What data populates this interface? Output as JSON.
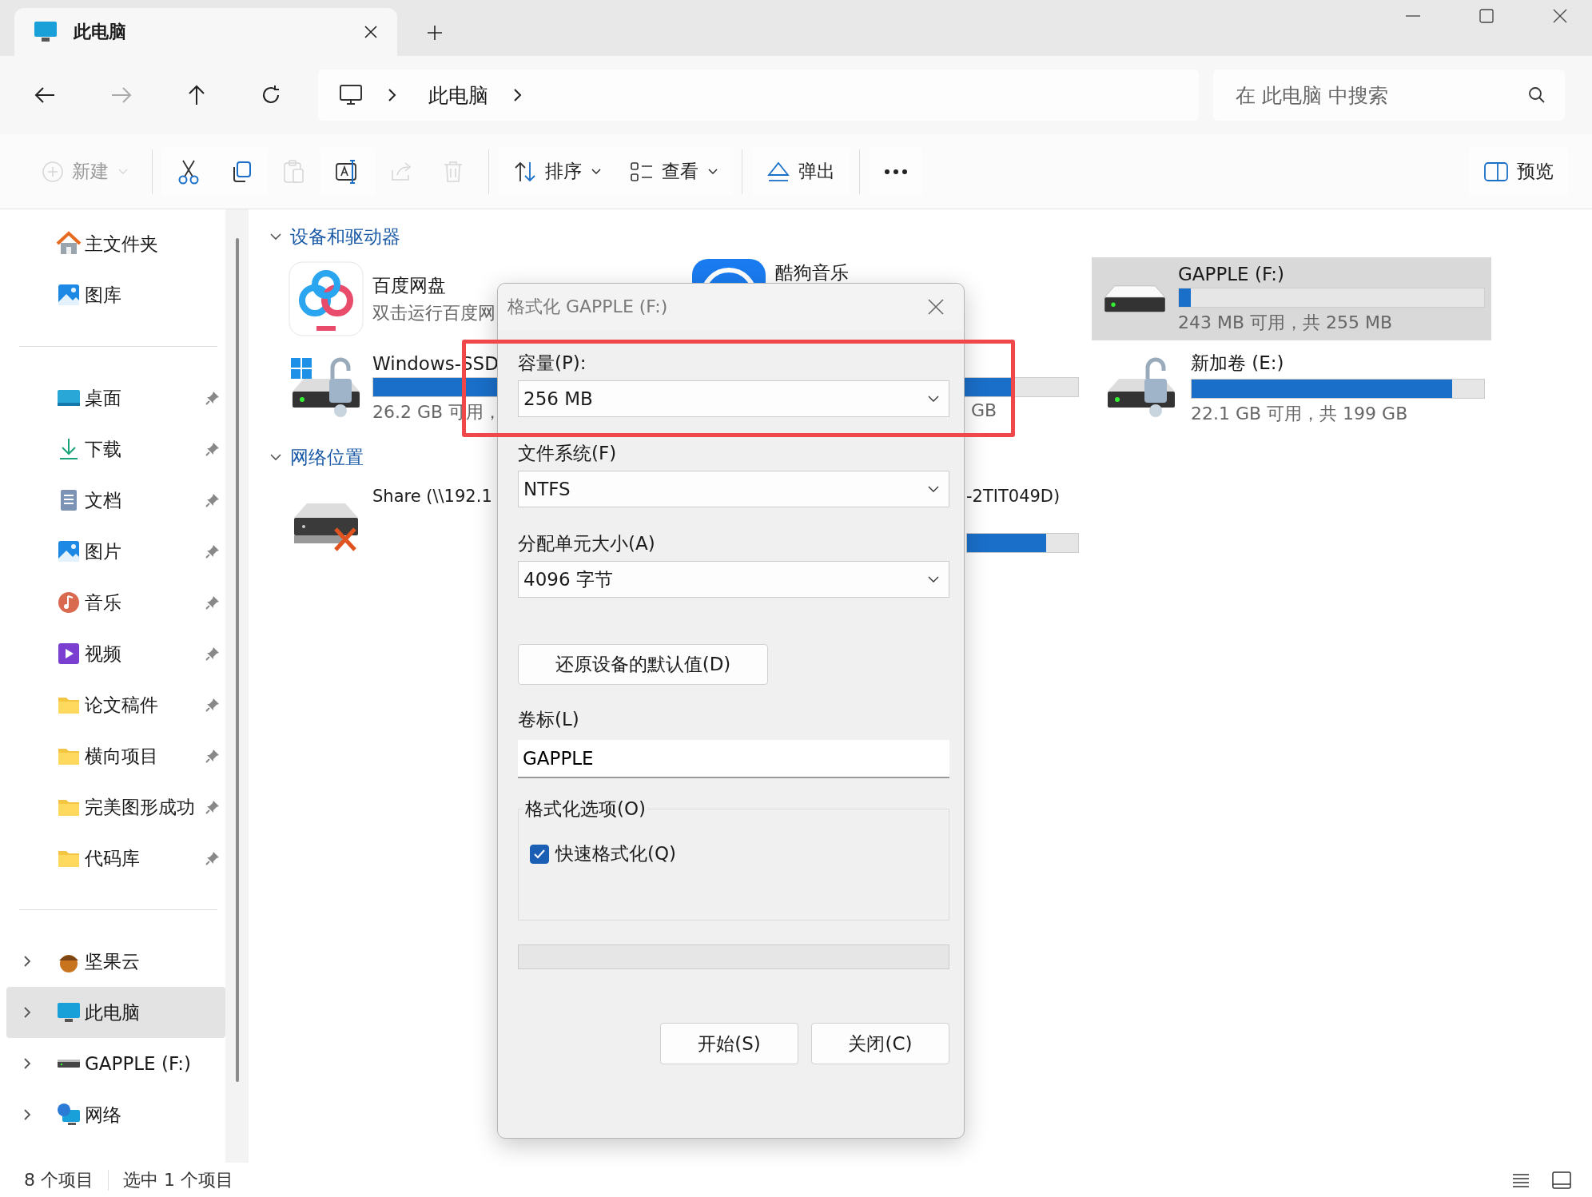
{
  "window": {
    "tab_title": "此电脑"
  },
  "nav": {
    "back_disabled": false,
    "forward_disabled": true,
    "breadcrumb": [
      "此电脑"
    ],
    "search": {
      "placeholder": "在 此电脑 中搜索"
    }
  },
  "toolbar": [
    {
      "kind": "new",
      "label": "新建",
      "disabled": true
    },
    {
      "kind": "separator"
    },
    {
      "kind": "cut",
      "disabled": false
    },
    {
      "kind": "copy",
      "disabled": false
    },
    {
      "kind": "paste",
      "disabled": true
    },
    {
      "kind": "rename",
      "disabled": false
    },
    {
      "kind": "share",
      "disabled": true
    },
    {
      "kind": "delete",
      "disabled": true
    },
    {
      "kind": "separator"
    },
    {
      "kind": "sort",
      "label": "排序",
      "disabled": false
    },
    {
      "kind": "view",
      "label": "查看",
      "disabled": false
    },
    {
      "kind": "separator"
    },
    {
      "kind": "eject",
      "label": "弹出",
      "disabled": false
    },
    {
      "kind": "separator"
    },
    {
      "kind": "more"
    },
    {
      "kind": "preview",
      "label": "预览",
      "disabled": false
    }
  ],
  "sidebar": {
    "sections": [
      {
        "items": [
          {
            "label": "主文件夹",
            "kind": "home",
            "selected": false
          },
          {
            "label": "图库",
            "kind": "gallery",
            "selected": false
          }
        ]
      },
      {
        "items": [
          {
            "label": "桌面",
            "kind": "desktop",
            "pinned": true,
            "selected": false
          },
          {
            "label": "下载",
            "kind": "download",
            "pinned": true,
            "selected": false
          },
          {
            "label": "文档",
            "kind": "document",
            "pinned": true,
            "selected": false
          },
          {
            "label": "图片",
            "kind": "pictures",
            "pinned": true,
            "selected": false
          },
          {
            "label": "音乐",
            "kind": "music",
            "pinned": true,
            "selected": false
          },
          {
            "label": "视频",
            "kind": "video",
            "pinned": true,
            "selected": false
          },
          {
            "label": "论文稿件",
            "kind": "folder",
            "pinned": true,
            "selected": false
          },
          {
            "label": "横向项目",
            "kind": "folder",
            "pinned": true,
            "selected": false
          },
          {
            "label": "完美图形成功",
            "kind": "folder",
            "pinned": true,
            "selected": false
          },
          {
            "label": "代码库",
            "kind": "folder",
            "pinned": true,
            "selected": false
          }
        ]
      },
      {
        "items": [
          {
            "label": "坚果云",
            "kind": "nut",
            "expanded": false,
            "selected": false
          },
          {
            "label": "此电脑",
            "kind": "pc",
            "expanded": false,
            "selected": true
          },
          {
            "label": "GAPPLE (F:)",
            "kind": "drive",
            "expanded": false,
            "selected": false
          },
          {
            "label": "网络",
            "kind": "network",
            "expanded": false,
            "selected": false
          }
        ]
      }
    ]
  },
  "content": {
    "sections": [
      {
        "title": "设备和驱动器",
        "expanded": true,
        "items": [
          {
            "kind": "cloud_app",
            "name": "百度网盘",
            "detail": "双击运行百度网",
            "selected": false
          },
          {
            "kind": "music_app",
            "name": "酷狗音乐",
            "selected": false
          },
          {
            "kind": "removable_drive",
            "name": "GAPPLE (F:)",
            "level": 0.04,
            "detail": "243 MB 可用，共 255 MB",
            "selected": true
          },
          {
            "kind": "system_drive",
            "name": "Windows-SSD",
            "level": 0.906,
            "detail": "26.2 GB 可用，",
            "detail_tail": "GB",
            "selected": false
          },
          {
            "kind": "locked_drive",
            "name": "新加卷 (E:)",
            "level": 0.89,
            "detail": "22.1 GB 可用，共 199 GB",
            "selected": false
          }
        ]
      },
      {
        "title": "网络位置",
        "expanded": true,
        "items": [
          {
            "kind": "network_drive",
            "name": "Share (\\\\192.1",
            "name_tail": "-2TIT049D)",
            "level": 0.71,
            "selected": false
          }
        ]
      }
    ]
  },
  "dialog": {
    "title": "格式化 GAPPLE (F:)",
    "fields": [
      {
        "label": "容量(P):",
        "value": "256 MB"
      },
      {
        "label": "文件系统(F)",
        "value": "NTFS"
      },
      {
        "label": "分配单元大小(A)",
        "value": "4096 字节"
      }
    ],
    "restore_button": "还原设备的默认值(D)",
    "volume_label": {
      "label": "卷标(L)",
      "value": "GAPPLE"
    },
    "options": {
      "title": "格式化选项(O)",
      "checkboxes": [
        {
          "label": "快速格式化(Q)",
          "checked": true
        }
      ]
    },
    "progress": {
      "level": 0
    },
    "buttons": [
      "开始(S)",
      "关闭(C)"
    ]
  },
  "status_bar": [
    "8 个项目",
    "选中 1 个项目"
  ]
}
